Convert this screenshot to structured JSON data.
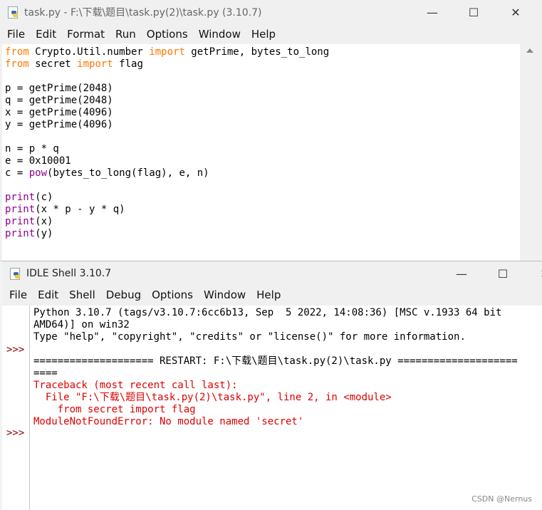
{
  "editor_window": {
    "title": "task.py - F:\\下载\\题目\\task.py(2)\\task.py (3.10.7)",
    "controls": {
      "minimize": "—",
      "maximize": "☐",
      "close": "✕"
    },
    "menu": [
      "File",
      "Edit",
      "Format",
      "Run",
      "Options",
      "Window",
      "Help"
    ],
    "code": {
      "l1_kw1": "from",
      "l1_a": " Crypto.Util.number ",
      "l1_kw2": "import",
      "l1_b": " getPrime, bytes_to_long",
      "l2_kw1": "from",
      "l2_a": " secret ",
      "l2_kw2": "import",
      "l2_b": " flag",
      "l4": "p = getPrime(2048)",
      "l5": "q = getPrime(2048)",
      "l6": "x = getPrime(4096)",
      "l7": "y = getPrime(4096)",
      "l9": "n = p * q",
      "l10": "e = 0x10001",
      "l11_a": "c = ",
      "l11_bi": "pow",
      "l11_b": "(bytes_to_long(flag), e, n)",
      "l13_bi": "print",
      "l13": "(c)",
      "l14_bi": "print",
      "l14": "(x * p - y * q)",
      "l15_bi": "print",
      "l15": "(x)",
      "l16_bi": "print",
      "l16": "(y)"
    }
  },
  "shell_window": {
    "title": "IDLE Shell 3.10.7",
    "controls": {
      "minimize": "—",
      "maximize": "☐",
      "close": "✕"
    },
    "menu": [
      "File",
      "Edit",
      "Shell",
      "Debug",
      "Options",
      "Window",
      "Help"
    ],
    "prompts": [
      ">>>",
      ">>>"
    ],
    "output": {
      "banner1": "Python 3.10.7 (tags/v3.10.7:6cc6b13, Sep  5 2022, 14:08:36) [MSC v.1933 64 bit",
      "banner2": "AMD64)] on win32",
      "banner3": "Type \"help\", \"copyright\", \"credits\" or \"license()\" for more information.",
      "restart1": "==================== RESTART: F:\\下载\\题目\\task.py(2)\\task.py ====================",
      "restart2": "====",
      "err1": "Traceback (most recent call last):",
      "err2": "  File \"F:\\下载\\题目\\task.py(2)\\task.py\", line 2, in <module>",
      "err3": "    from secret import flag",
      "err4": "ModuleNotFoundError: No module named 'secret'"
    }
  },
  "watermark": "CSDN @Nernus"
}
